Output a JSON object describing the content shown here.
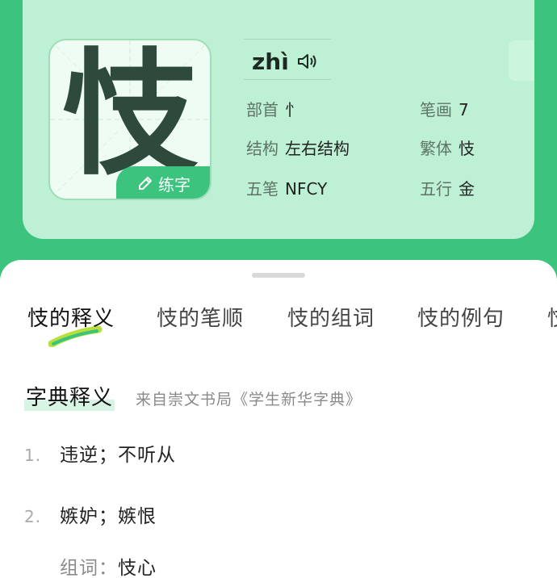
{
  "character": {
    "glyph": "忮",
    "pinyin": "zhì",
    "practice_label": "练字"
  },
  "attributes": {
    "radical": {
      "label": "部首",
      "value": "忄"
    },
    "strokes": {
      "label": "笔画",
      "value": "7"
    },
    "structure": {
      "label": "结构",
      "value": "左右结构"
    },
    "traditional": {
      "label": "繁体",
      "value": "忮"
    },
    "wubi": {
      "label": "五笔",
      "value": "NFCY"
    },
    "wuxing": {
      "label": "五行",
      "value": "金"
    }
  },
  "tabs": [
    {
      "label": "忮的释义"
    },
    {
      "label": "忮的笔顺"
    },
    {
      "label": "忮的组词"
    },
    {
      "label": "忮的例句"
    },
    {
      "label": "忮"
    }
  ],
  "definition_section": {
    "title": "字典释义",
    "source": "来自崇文书局《学生新华字典》",
    "items": [
      {
        "num": "1.",
        "text": "违逆；不听从"
      },
      {
        "num": "2.",
        "text": "嫉妒；嫉恨"
      }
    ],
    "words_label": "组词：",
    "words_value": "忮心"
  },
  "colors": {
    "brand_green": "#3cc47f",
    "card_bg": "#bdf0d4"
  }
}
